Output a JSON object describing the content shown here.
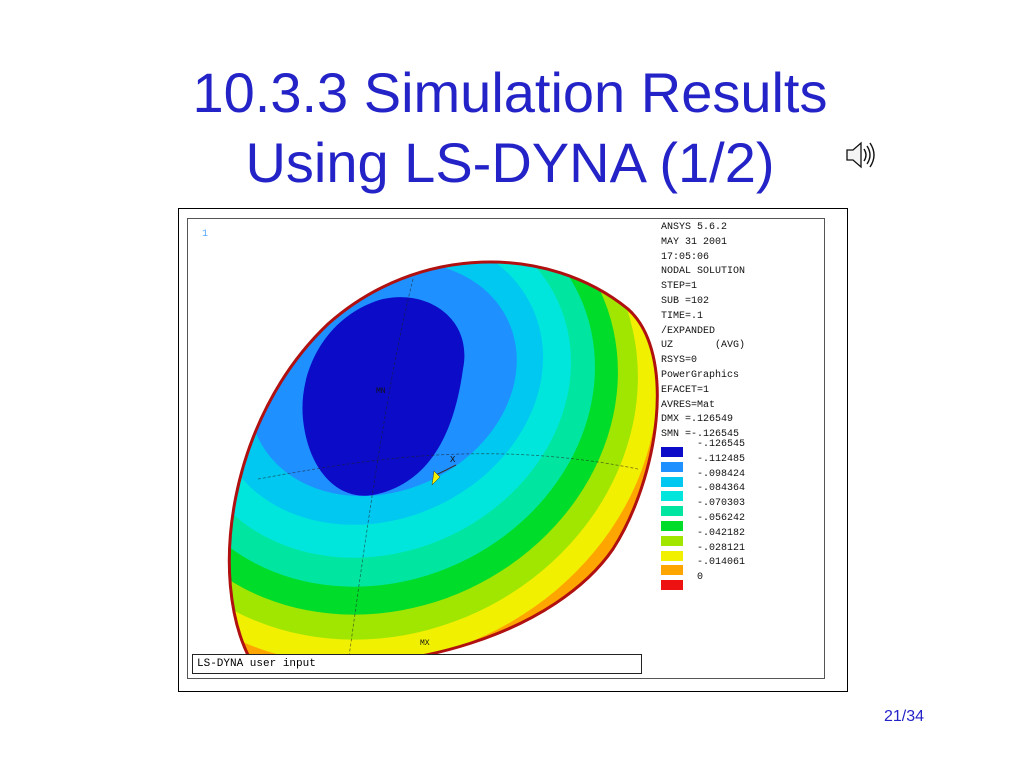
{
  "slide": {
    "title_line1": "10.3.3  Simulation Results",
    "title_line2": "Using LS-DYNA (1/2)",
    "page_number": "21/34",
    "speaker_icon": "speaker-audio-icon"
  },
  "figure": {
    "corner_mark": "1",
    "bottom_label": "LS-DYNA user input",
    "axis_label_x": "X",
    "mx_label": "MX",
    "mn_label": "MN",
    "info_lines": [
      "ANSYS 5.6.2",
      "MAY 31 2001",
      "17:05:06",
      "NODAL SOLUTION",
      "STEP=1",
      "SUB =102",
      "TIME=.1",
      "/EXPANDED",
      "UZ       (AVG)",
      "RSYS=0",
      "PowerGraphics",
      "EFACET=1",
      "AVRES=Mat",
      "DMX =.126549",
      "SMN =-.126545"
    ],
    "legend": [
      {
        "label": "-.126545",
        "color": "#0b0bc8"
      },
      {
        "label": "-.112485",
        "color": "#1e90ff"
      },
      {
        "label": "-.098424",
        "color": "#00c8f0"
      },
      {
        "label": "-.084364",
        "color": "#00e6dc"
      },
      {
        "label": "-.070303",
        "color": "#00e6a0"
      },
      {
        "label": "-.056242",
        "color": "#00dc2a"
      },
      {
        "label": "-.042182",
        "color": "#a0e600"
      },
      {
        "label": "-.028121",
        "color": "#f0f000"
      },
      {
        "label": "-.014061",
        "color": "#ffa500"
      },
      {
        "label": "0",
        "color": "#ee1111"
      }
    ]
  }
}
